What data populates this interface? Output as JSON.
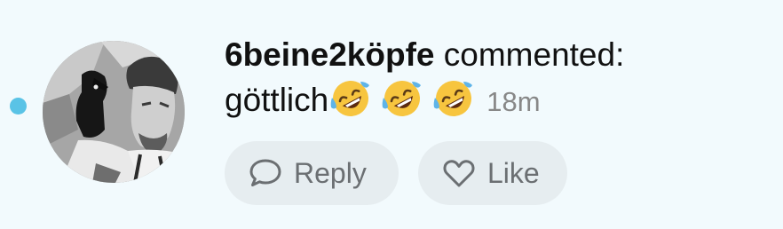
{
  "notification": {
    "username": "6beine2köpfe",
    "action_text": "commented:",
    "comment_text": "göttlich",
    "emojis": [
      "rolling-on-floor-laughing-emoji",
      "rolling-on-floor-laughing-emoji",
      "rolling-on-floor-laughing-emoji"
    ],
    "time_ago": "18m",
    "unread": true
  },
  "actions": {
    "reply_label": "Reply",
    "like_label": "Like"
  },
  "colors": {
    "background": "#f2fafd",
    "unread_dot": "#5ac3e6",
    "button_bg": "#e6edf0",
    "button_text": "#6b6f72",
    "text": "#111111",
    "time_text": "#888888"
  }
}
